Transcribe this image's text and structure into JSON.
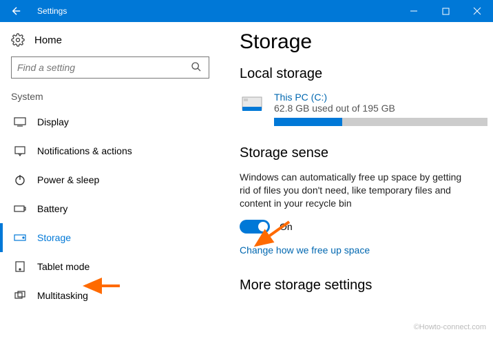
{
  "window": {
    "title": "Settings"
  },
  "sidebar": {
    "home": "Home",
    "search_placeholder": "Find a setting",
    "category": "System",
    "items": [
      {
        "label": "Display"
      },
      {
        "label": "Notifications & actions"
      },
      {
        "label": "Power & sleep"
      },
      {
        "label": "Battery"
      },
      {
        "label": "Storage"
      },
      {
        "label": "Tablet mode"
      },
      {
        "label": "Multitasking"
      }
    ]
  },
  "page": {
    "title": "Storage",
    "local_heading": "Local storage",
    "disk": {
      "name": "This PC (C:)",
      "usage_text": "62.8 GB used out of 195 GB",
      "used_pct": 32
    },
    "sense_heading": "Storage sense",
    "sense_desc": "Windows can automatically free up space by getting rid of files you don't need, like temporary files and content in your recycle bin",
    "toggle_state": "On",
    "change_link": "Change how we free up space",
    "more_heading": "More storage settings"
  },
  "watermark": "©Howto-connect.com"
}
